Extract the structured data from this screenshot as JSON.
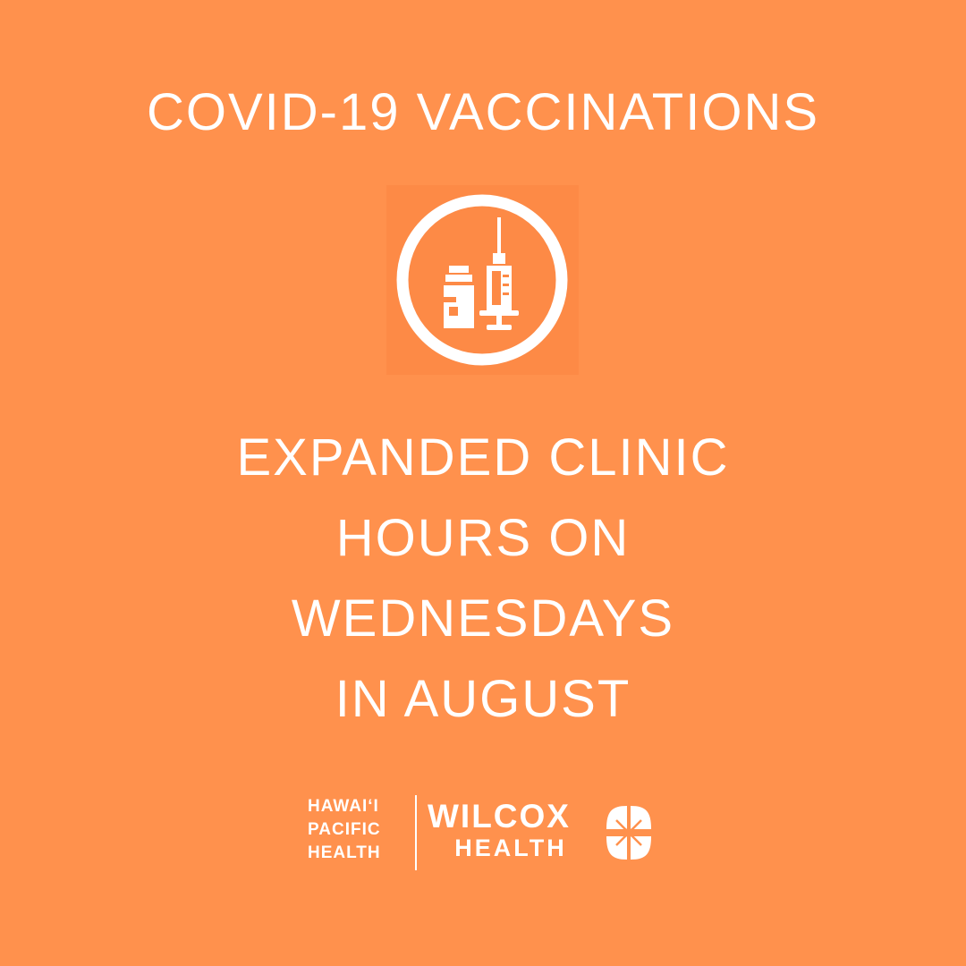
{
  "poster": {
    "headline": "COVID-19 VACCINATIONS",
    "icon": "vaccine-vial-syringe-icon",
    "message_lines": [
      "EXPANDED CLINIC",
      "HOURS ON",
      "WEDNESDAYS",
      "IN AUGUST"
    ]
  },
  "logo": {
    "left_lines": [
      "HAWAIʻI",
      "PACIFIC",
      "HEALTH"
    ],
    "brand": "WILCOX",
    "brand_sub": "HEALTH",
    "mark_icon": "wilcox-flower-mark-icon"
  },
  "colors": {
    "background": "#ff914d",
    "icon_tile": "#fd8a46",
    "text": "#ffffff"
  }
}
